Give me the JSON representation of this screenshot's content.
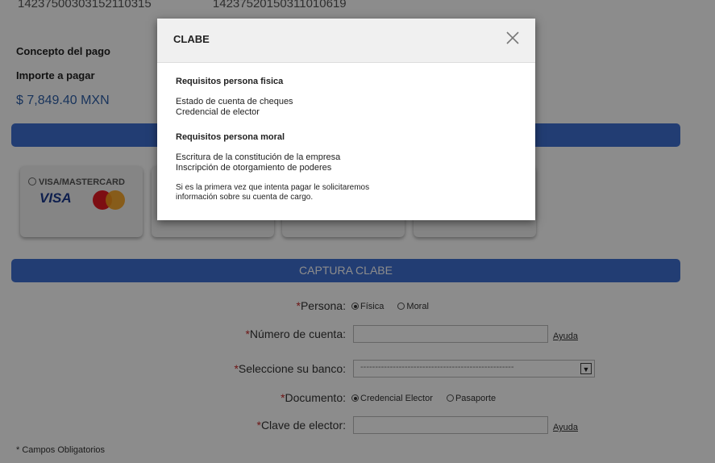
{
  "references": [
    "14237500303152110315",
    "14237520150311010619"
  ],
  "payment": {
    "concept_label": "Concepto del pago",
    "amount_label": "Importe a pagar",
    "amount_value": "$ 7,849.40 MXN"
  },
  "payment_methods": [
    {
      "label": "VISA/MASTERCARD",
      "brand1": "VISA",
      "selected": false
    },
    {
      "label": "",
      "selected": false
    },
    {
      "label": "",
      "selected": false
    },
    {
      "label": "",
      "selected": false
    }
  ],
  "section_title": "CAPTURA CLABE",
  "form": {
    "required_mark": "*",
    "persona": {
      "label": "Persona:",
      "options": [
        "Física",
        "Moral"
      ],
      "selected": "Física"
    },
    "cuenta": {
      "label": "Número de cuenta:",
      "value": "",
      "help": "Ayuda"
    },
    "banco": {
      "label": "Seleccione su banco:",
      "selected": "----------------------------------------------------"
    },
    "documento": {
      "label": "Documento:",
      "options": [
        "Credencial Elector",
        "Pasaporte"
      ],
      "selected": "Credencial Elector"
    },
    "clave": {
      "label": "Clave de elector:",
      "value": "",
      "help": "Ayuda"
    }
  },
  "footnote": "* Campos Obligatorios",
  "modal": {
    "title": "CLABE",
    "fisica_heading": "Requisitos persona fisica",
    "fisica_items": [
      "Estado de cuenta de cheques",
      "Credencial de elector"
    ],
    "moral_heading": "Requisitos persona moral",
    "moral_items": [
      "Escritura de la constitución de la empresa",
      "Inscripción de otorgamiento de poderes"
    ],
    "note_lines": [
      "Si es la primera vez que intenta pagar le solicitaremos",
      "información sobre su cuenta de cargo."
    ]
  },
  "colors": {
    "accent": "#3f6fd1",
    "amount": "#2e5fa8",
    "required": "#c62828"
  },
  "icons": {
    "close": "close-icon",
    "dropdown": "chevron-down-icon"
  }
}
